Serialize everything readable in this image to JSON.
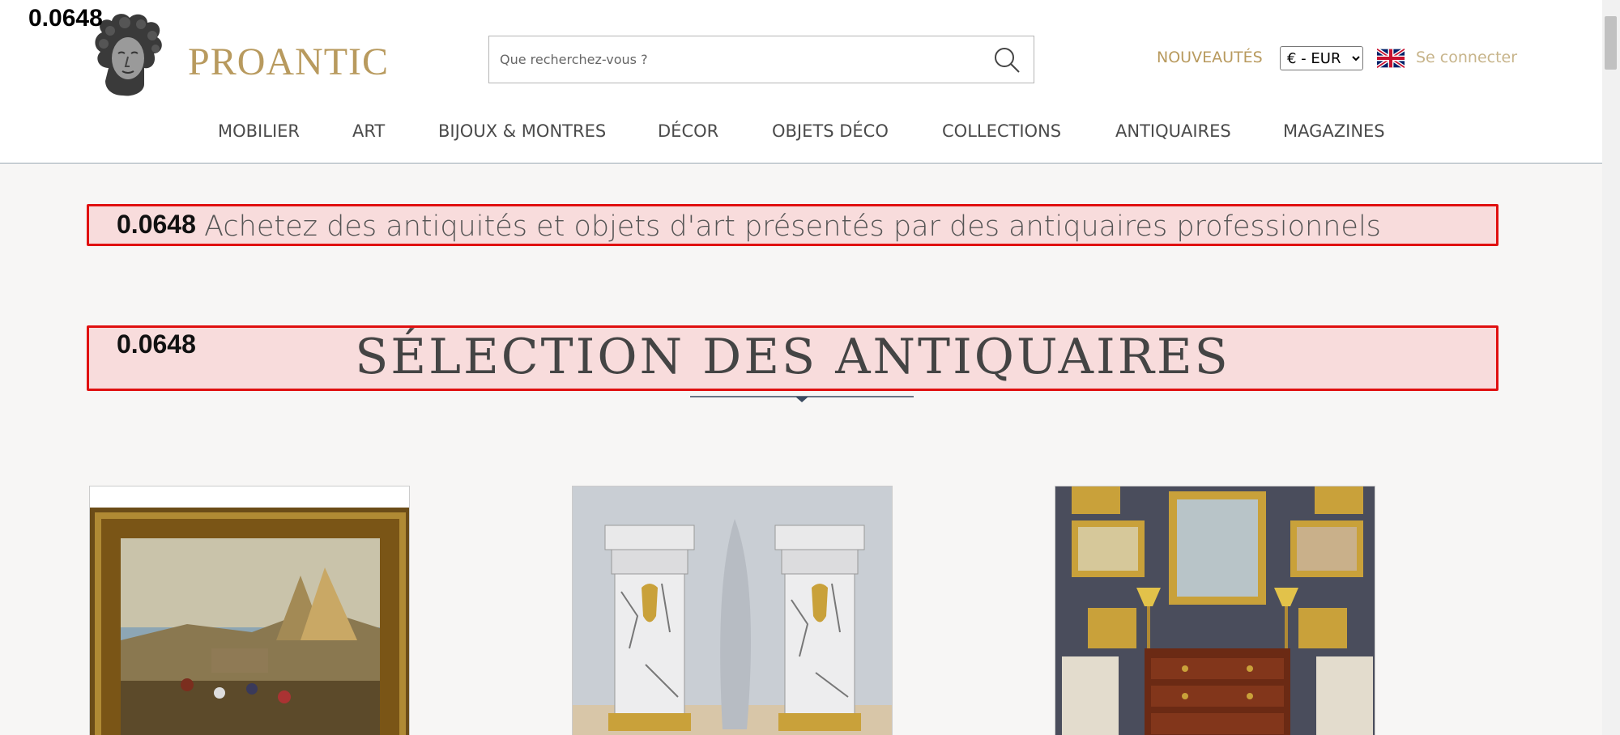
{
  "debug": {
    "score": "0.0648"
  },
  "brand": {
    "name": "PROANTIC"
  },
  "search": {
    "placeholder": "Que recherchez-vous ?"
  },
  "header": {
    "new_label": "NOUVEAUTÉS",
    "currency_selected": "€ - EUR",
    "login_label": "Se connecter"
  },
  "nav": {
    "items": [
      {
        "label": "MOBILIER"
      },
      {
        "label": "ART"
      },
      {
        "label": "BIJOUX & MONTRES"
      },
      {
        "label": "DÉCOR"
      },
      {
        "label": "OBJETS DÉCO"
      },
      {
        "label": "COLLECTIONS"
      },
      {
        "label": "ANTIQUAIRES"
      },
      {
        "label": "MAGAZINES"
      }
    ]
  },
  "main": {
    "tagline": "Achetez des antiquités et objets d'art présentés par des antiquaires professionnels",
    "section_title": "SÉLECTION DES ANTIQUAIRES"
  },
  "colors": {
    "accent_gold": "#b89a5e",
    "banner_border": "#e01010",
    "banner_fill": "#f8dcdc"
  }
}
